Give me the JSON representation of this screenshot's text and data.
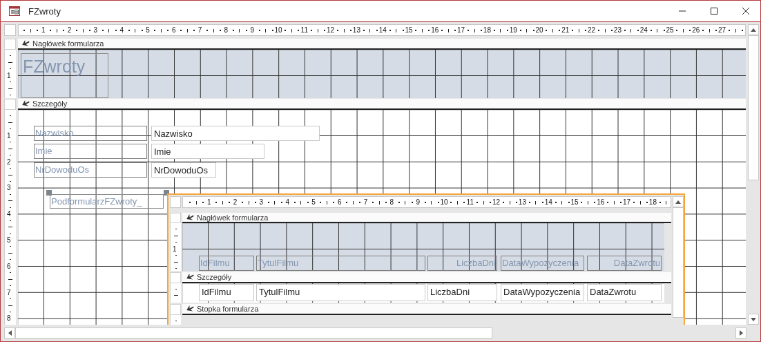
{
  "window": {
    "title": "FZwroty"
  },
  "ruler": {
    "marks": [
      "1",
      "2",
      "3",
      "4",
      "5",
      "6",
      "7",
      "8",
      "9",
      "10",
      "11",
      "12",
      "13",
      "14",
      "15",
      "16",
      "17",
      "18",
      "19",
      "20",
      "21",
      "22",
      "23",
      "24",
      "25",
      "26",
      "27"
    ]
  },
  "vertical_ruler": {
    "header_marks": [
      "1"
    ],
    "detail_marks": [
      "1",
      "2",
      "3",
      "4",
      "5",
      "6",
      "7",
      "8"
    ]
  },
  "form_header": {
    "name": "Nagłówek formularza",
    "title": "FZwroty"
  },
  "detail": {
    "name": "Szczegóły",
    "fields": [
      {
        "label": "Nazwisko",
        "textbox": "Nazwisko"
      },
      {
        "label": "Imie",
        "textbox": "Imie"
      },
      {
        "label": "NrDowoduOs",
        "textbox": "NrDowoduOs"
      }
    ]
  },
  "subform": {
    "label": "PodformularzFZwroty_",
    "selected": true,
    "ruler": {
      "marks": [
        "1",
        "2",
        "3",
        "4",
        "5",
        "6",
        "7",
        "8",
        "9",
        "10",
        "11",
        "12",
        "13",
        "14",
        "15",
        "16",
        "17",
        "18"
      ]
    },
    "vertical_ruler": {
      "header_marks": [
        "1"
      ]
    },
    "form_header": {
      "name": "Nagłówek formularza",
      "labels": [
        {
          "text": "IdFilmu",
          "right_aligned": false
        },
        {
          "text": "TytulFilmu",
          "right_aligned": false
        },
        {
          "text": "LiczbaDni",
          "right_aligned": true
        },
        {
          "text": "DataWypozyczenia",
          "right_aligned": false
        },
        {
          "text": "DataZwrotu",
          "right_aligned": true
        }
      ]
    },
    "detail": {
      "name": "Szczegóły",
      "textboxes": [
        "IdFilmu",
        "TytulFilmu",
        "LiczbaDni",
        "DataWypozyczenia",
        "DataZwrotu"
      ]
    },
    "form_footer": {
      "name": "Stopka formularza"
    }
  }
}
